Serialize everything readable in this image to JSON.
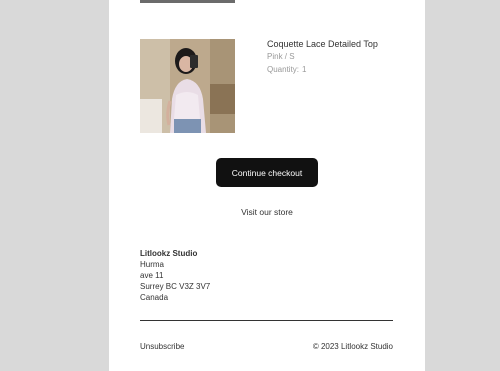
{
  "product": {
    "title": "Coquette Lace Detailed Top",
    "variant": "Pink / S",
    "quantity_label": "Quantity:",
    "quantity_value": "1"
  },
  "actions": {
    "checkout_label": "Continue checkout",
    "store_label": "Visit our store"
  },
  "address": {
    "shop_name": "Litlookz Studio",
    "line1": "Hurma",
    "line2": "ave 11",
    "line3": "Surrey BC V3Z 3V7",
    "line4": "Canada"
  },
  "footer": {
    "unsubscribe_label": "Unsubscribe",
    "copyright": "© 2023 Litlookz Studio"
  },
  "colors": {
    "page_background": "#d9d9d9",
    "card_background": "#ffffff",
    "button_background": "#111111",
    "muted_text": "#999999"
  }
}
